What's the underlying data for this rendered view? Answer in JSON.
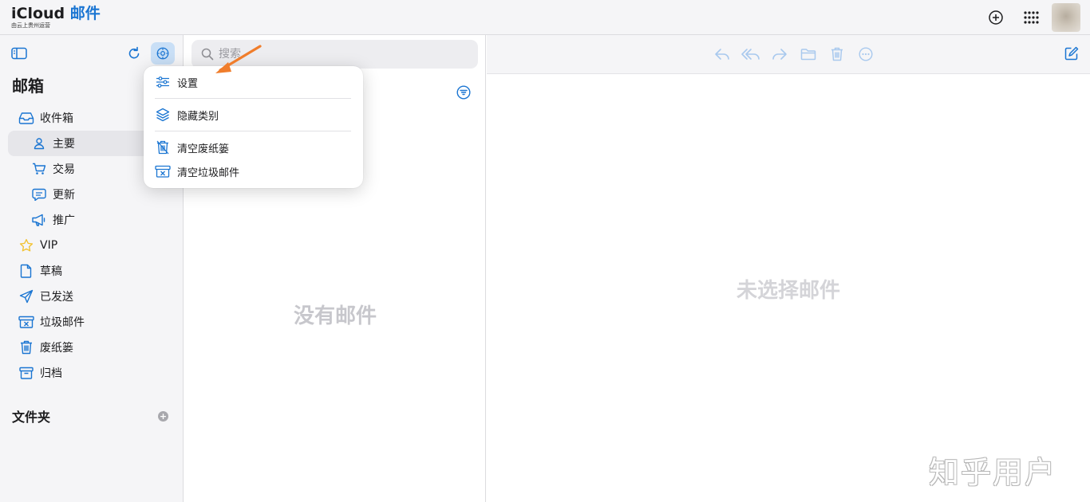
{
  "header": {
    "brand": "iCloud",
    "app_name": "邮件",
    "operator_note": "由云上贵州运营"
  },
  "sidebar": {
    "title": "邮箱",
    "items": [
      {
        "label": "收件箱",
        "icon": "inbox-icon"
      },
      {
        "label": "主要",
        "icon": "person-icon"
      },
      {
        "label": "交易",
        "icon": "cart-icon"
      },
      {
        "label": "更新",
        "icon": "message-icon"
      },
      {
        "label": "推广",
        "icon": "megaphone-icon"
      },
      {
        "label": "VIP",
        "icon": "star-icon"
      },
      {
        "label": "草稿",
        "icon": "document-icon"
      },
      {
        "label": "已发送",
        "icon": "paperplane-icon"
      },
      {
        "label": "垃圾邮件",
        "icon": "junk-icon"
      },
      {
        "label": "废纸篓",
        "icon": "trash-icon"
      },
      {
        "label": "归档",
        "icon": "archive-icon"
      }
    ],
    "folders_title": "文件夹",
    "add_folder_symbol": "+"
  },
  "list": {
    "search_placeholder": "搜索",
    "empty_text": "没有邮件"
  },
  "reader": {
    "empty_text": "未选择邮件"
  },
  "menu": {
    "items": [
      {
        "label": "设置",
        "icon": "sliders-icon"
      },
      {
        "label": "隐藏类别",
        "icon": "layers-icon"
      },
      {
        "label": "清空废纸篓",
        "icon": "trash-clear-icon"
      },
      {
        "label": "清空垃圾邮件",
        "icon": "junk-clear-icon"
      }
    ]
  },
  "watermark": "知乎用户",
  "colors": {
    "accent": "#1a75d2",
    "arrow": "#f07d2b",
    "sidebar_bg": "#f5f5f7",
    "vip_star": "#f2c230"
  }
}
